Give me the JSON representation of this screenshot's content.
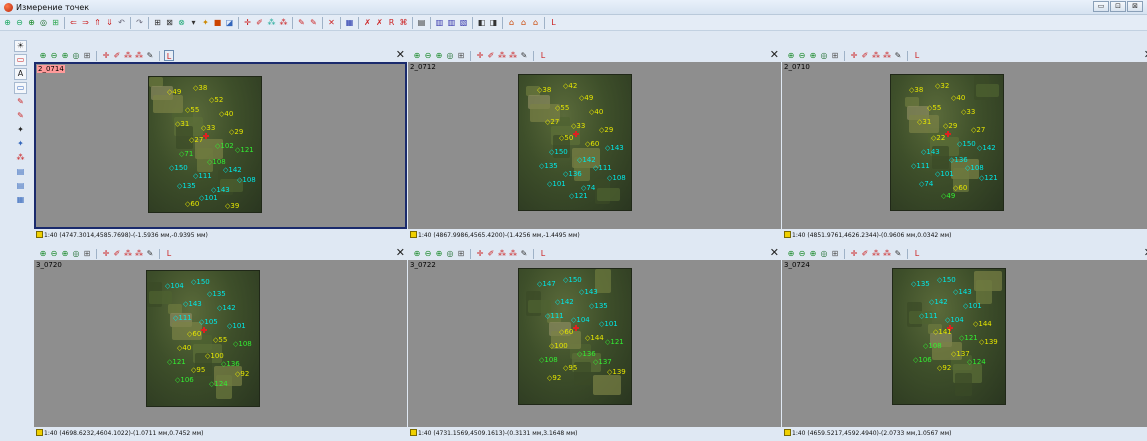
{
  "window": {
    "title": "Измерение точек",
    "controls": [
      "▭",
      "⊡",
      "⊠"
    ]
  },
  "toolbar": {
    "buttons": [
      "⊕",
      "⊖",
      "⊕",
      "◎",
      "⊞",
      "|",
      "⇐",
      "⇒",
      "⇑",
      "⇓",
      "↶",
      "|",
      "↷",
      "|",
      "⊞",
      "⊠",
      "⊗",
      "▾",
      "✦",
      "■",
      "◪",
      "|",
      "✛",
      "✐",
      "⁂",
      "⁂",
      "|",
      "✎",
      "✎",
      "|",
      "✕",
      "|",
      "▦",
      "|",
      "✗",
      "✗",
      "R",
      "⌘",
      "|",
      "▤",
      "|",
      "▥",
      "▥",
      "▧",
      "|",
      "◧",
      "◨",
      "|",
      "⌂",
      "⌂",
      "⌂",
      "|",
      "L"
    ]
  },
  "left_toolbar": {
    "buttons": [
      "☀",
      "▭",
      "A",
      "▭",
      "✎",
      "✎",
      "✦",
      "✦",
      "⁂",
      "▤",
      "▤",
      "▦"
    ]
  },
  "panel_toolbar": {
    "icons": [
      "⊕",
      "⊖",
      "⊕",
      "◎",
      "⊞",
      "|",
      "✛",
      "✐",
      "⁂",
      "⁂",
      "✎"
    ],
    "last": "L",
    "close": "✕"
  },
  "panels": [
    {
      "id": "2_0714",
      "status": "1:40 (4747.3014,4585.7698)-(-1.5936 мм,-0.9395 мм)",
      "active": true,
      "points": [
        {
          "t": "◇49",
          "c": "#e6e600"
        },
        {
          "t": "◇38",
          "c": "#e6e600"
        },
        {
          "t": "◇52",
          "c": "#e6e600"
        },
        {
          "t": "◇55",
          "c": "#e6e600"
        },
        {
          "t": "◇40",
          "c": "#e6e600"
        },
        {
          "t": "◇31",
          "c": "#e6e600"
        },
        {
          "t": "◇33",
          "c": "#e6e600"
        },
        {
          "t": "◇29",
          "c": "#e6e600"
        },
        {
          "t": "◇27",
          "c": "#e6e600"
        },
        {
          "t": "◇102",
          "c": "#33ee33"
        },
        {
          "t": "◇71",
          "c": "#33ee33"
        },
        {
          "t": "◇121",
          "c": "#33ee33"
        },
        {
          "t": "◇108",
          "c": "#33ee33"
        },
        {
          "t": "◇150",
          "c": "#00e8e8"
        },
        {
          "t": "◇142",
          "c": "#00e8e8"
        },
        {
          "t": "◇111",
          "c": "#00e8e8"
        },
        {
          "t": "◇108",
          "c": "#00e8e8"
        },
        {
          "t": "◇135",
          "c": "#00e8e8"
        },
        {
          "t": "◇143",
          "c": "#00e8e8"
        },
        {
          "t": "◇101",
          "c": "#00e8e8"
        },
        {
          "t": "◇60",
          "c": "#e6e600"
        },
        {
          "t": "◇39",
          "c": "#e6e600"
        }
      ]
    },
    {
      "id": "2_0712",
      "status": "1:40 (4867.9986,4565.4200)-(1.4256 мм,-1.4495 мм)",
      "active": false,
      "points": [
        {
          "t": "◇38",
          "c": "#e6e600"
        },
        {
          "t": "◇42",
          "c": "#e6e600"
        },
        {
          "t": "◇49",
          "c": "#e6e600"
        },
        {
          "t": "◇55",
          "c": "#e6e600"
        },
        {
          "t": "◇40",
          "c": "#e6e600"
        },
        {
          "t": "◇27",
          "c": "#e6e600"
        },
        {
          "t": "◇33",
          "c": "#e6e600"
        },
        {
          "t": "◇29",
          "c": "#e6e600"
        },
        {
          "t": "◇50",
          "c": "#e6e600"
        },
        {
          "t": "◇60",
          "c": "#e6e600"
        },
        {
          "t": "◇150",
          "c": "#00e8e8"
        },
        {
          "t": "◇143",
          "c": "#00e8e8"
        },
        {
          "t": "◇142",
          "c": "#00e8e8"
        },
        {
          "t": "◇135",
          "c": "#00e8e8"
        },
        {
          "t": "◇111",
          "c": "#00e8e8"
        },
        {
          "t": "◇136",
          "c": "#00e8e8"
        },
        {
          "t": "◇108",
          "c": "#00e8e8"
        },
        {
          "t": "◇101",
          "c": "#00e8e8"
        },
        {
          "t": "◇74",
          "c": "#00e8e8"
        },
        {
          "t": "◇121",
          "c": "#00e8e8"
        }
      ]
    },
    {
      "id": "2_0710",
      "status": "1:40 (4851.9761,4626.2344)-(0.9606 мм,0.0342 мм)",
      "active": false,
      "points": [
        {
          "t": "◇38",
          "c": "#e6e600"
        },
        {
          "t": "◇32",
          "c": "#e6e600"
        },
        {
          "t": "◇40",
          "c": "#e6e600"
        },
        {
          "t": "◇55",
          "c": "#e6e600"
        },
        {
          "t": "◇33",
          "c": "#e6e600"
        },
        {
          "t": "◇31",
          "c": "#e6e600"
        },
        {
          "t": "◇29",
          "c": "#e6e600"
        },
        {
          "t": "◇27",
          "c": "#e6e600"
        },
        {
          "t": "◇22",
          "c": "#e6e600"
        },
        {
          "t": "◇150",
          "c": "#00e8e8"
        },
        {
          "t": "◇143",
          "c": "#00e8e8"
        },
        {
          "t": "◇142",
          "c": "#00e8e8"
        },
        {
          "t": "◇136",
          "c": "#00e8e8"
        },
        {
          "t": "◇111",
          "c": "#00e8e8"
        },
        {
          "t": "◇108",
          "c": "#00e8e8"
        },
        {
          "t": "◇101",
          "c": "#00e8e8"
        },
        {
          "t": "◇121",
          "c": "#00e8e8"
        },
        {
          "t": "◇74",
          "c": "#00e8e8"
        },
        {
          "t": "◇60",
          "c": "#e6e600"
        },
        {
          "t": "◇49",
          "c": "#33ee33"
        }
      ]
    },
    {
      "id": "3_0720",
      "status": "1:40 (4698.6232,4604.1022)-(1.0711 мм,0.7452 мм)",
      "active": false,
      "points": [
        {
          "t": "◇104",
          "c": "#00e8e8"
        },
        {
          "t": "◇150",
          "c": "#00e8e8"
        },
        {
          "t": "◇135",
          "c": "#00e8e8"
        },
        {
          "t": "◇143",
          "c": "#00e8e8"
        },
        {
          "t": "◇142",
          "c": "#00e8e8"
        },
        {
          "t": "◇111",
          "c": "#00e8e8"
        },
        {
          "t": "◇105",
          "c": "#00e8e8"
        },
        {
          "t": "◇101",
          "c": "#00e8e8"
        },
        {
          "t": "◇60",
          "c": "#e6e600"
        },
        {
          "t": "◇55",
          "c": "#e6e600"
        },
        {
          "t": "◇40",
          "c": "#e6e600"
        },
        {
          "t": "◇108",
          "c": "#33ee33"
        },
        {
          "t": "◇100",
          "c": "#e6e600"
        },
        {
          "t": "◇121",
          "c": "#33ee33"
        },
        {
          "t": "◇136",
          "c": "#33ee33"
        },
        {
          "t": "◇95",
          "c": "#e6e600"
        },
        {
          "t": "◇92",
          "c": "#e6e600"
        },
        {
          "t": "◇106",
          "c": "#33ee33"
        },
        {
          "t": "◇124",
          "c": "#33ee33"
        }
      ]
    },
    {
      "id": "3_0722",
      "status": "1:40 (4731.1569,4509.1613)-(0.3131 мм,3.1648 мм)",
      "active": false,
      "points": [
        {
          "t": "◇147",
          "c": "#00e8e8"
        },
        {
          "t": "◇150",
          "c": "#00e8e8"
        },
        {
          "t": "◇143",
          "c": "#00e8e8"
        },
        {
          "t": "◇142",
          "c": "#00e8e8"
        },
        {
          "t": "◇135",
          "c": "#00e8e8"
        },
        {
          "t": "◇111",
          "c": "#00e8e8"
        },
        {
          "t": "◇104",
          "c": "#00e8e8"
        },
        {
          "t": "◇101",
          "c": "#00e8e8"
        },
        {
          "t": "◇60",
          "c": "#e6e600"
        },
        {
          "t": "◇144",
          "c": "#e6e600"
        },
        {
          "t": "◇100",
          "c": "#e6e600"
        },
        {
          "t": "◇121",
          "c": "#33ee33"
        },
        {
          "t": "◇136",
          "c": "#33ee33"
        },
        {
          "t": "◇108",
          "c": "#33ee33"
        },
        {
          "t": "◇137",
          "c": "#33ee33"
        },
        {
          "t": "◇95",
          "c": "#e6e600"
        },
        {
          "t": "◇139",
          "c": "#e6e600"
        },
        {
          "t": "◇92",
          "c": "#e6e600"
        }
      ]
    },
    {
      "id": "3_0724",
      "status": "1:40 (4659.5217,4592.4940)-(2.0733 мм,1.0567 мм)",
      "active": false,
      "points": [
        {
          "t": "◇135",
          "c": "#00e8e8"
        },
        {
          "t": "◇150",
          "c": "#00e8e8"
        },
        {
          "t": "◇143",
          "c": "#00e8e8"
        },
        {
          "t": "◇142",
          "c": "#00e8e8"
        },
        {
          "t": "◇101",
          "c": "#00e8e8"
        },
        {
          "t": "◇111",
          "c": "#00e8e8"
        },
        {
          "t": "◇104",
          "c": "#00e8e8"
        },
        {
          "t": "◇144",
          "c": "#e6e600"
        },
        {
          "t": "◇141",
          "c": "#e6e600"
        },
        {
          "t": "◇121",
          "c": "#33ee33"
        },
        {
          "t": "◇108",
          "c": "#33ee33"
        },
        {
          "t": "◇139",
          "c": "#e6e600"
        },
        {
          "t": "◇137",
          "c": "#e6e600"
        },
        {
          "t": "◇106",
          "c": "#33ee33"
        },
        {
          "t": "◇124",
          "c": "#33ee33"
        },
        {
          "t": "◇92",
          "c": "#e6e600"
        }
      ]
    }
  ]
}
